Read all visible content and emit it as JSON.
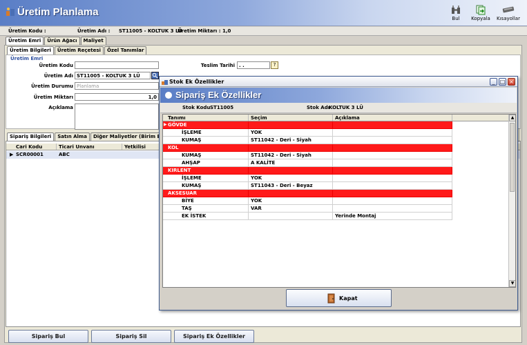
{
  "app": {
    "title": "Üretim Planlama"
  },
  "toolbar": {
    "find_label": "Bul",
    "copy_label": "Kopyala",
    "shortcuts_label": "Kısayollar"
  },
  "infobar": {
    "code_label": "Üretim Kodu :",
    "name_label": "Üretim Adı :",
    "name_value": "ST11005 - KOLTUK 3 LÜ",
    "qty_label": "Üretim Miktarı :",
    "qty_value": "1,0"
  },
  "main_tabs": [
    "Üretim Emri",
    "Ürün Ağacı",
    "Maliyet"
  ],
  "sub_tabs": [
    "Üretim Bilgileri",
    "Üretim Reçetesi",
    "Özel Tanımlar"
  ],
  "form": {
    "section_title": "Üretim Emri",
    "code_label": "Üretim Kodu",
    "code_value": "",
    "name_label": "Üretim Adı",
    "name_value": "ST11005 - KOLTUK 3 LÜ",
    "status_label": "Üretim Durumu",
    "status_value": "Planlama",
    "qty_label": "Üretim Miktarı",
    "qty_value": "1,0",
    "desc_label": "Açıklama",
    "delivery_label": "Teslim Tarihi",
    "delivery_value": ". ."
  },
  "bottom_tabs": [
    "Sipariş Bilgileri",
    "Satın Alma",
    "Diğer Maliyetler (Birim Bazında)"
  ],
  "orders": {
    "columns": [
      "Cari Kodu",
      "Ticari Unvanı",
      "Yetkilisi"
    ],
    "rows": [
      {
        "code": "SCR00001",
        "name": "ABC",
        "contact": ""
      }
    ]
  },
  "bottom_buttons": {
    "find": "Sipariş Bul",
    "delete": "Sipariş Sil",
    "extras": "Sipariş Ek Özellikler"
  },
  "dialog": {
    "window_title": "Stok Ek Özellikler",
    "header_title": "Sipariş Ek Özellikler",
    "stock_code_label": "Stok Kodu",
    "stock_code_value": "ST11005",
    "stock_name_label": "Stok Adı",
    "stock_name_value": "KOLTUK 3 LÜ",
    "columns": [
      "Tanımı",
      "Seçim",
      "Açıklama"
    ],
    "rows": [
      {
        "type": "group",
        "name": "GÖVDE",
        "choice": "",
        "note": ""
      },
      {
        "type": "item",
        "name": "İŞLEME",
        "choice": "YOK",
        "note": ""
      },
      {
        "type": "item",
        "name": "KUMAŞ",
        "choice": "ST11042 - Deri - Siyah",
        "note": ""
      },
      {
        "type": "group",
        "name": "KOL",
        "choice": "",
        "note": ""
      },
      {
        "type": "item",
        "name": "KUMAŞ",
        "choice": "ST11042 - Deri - Siyah",
        "note": ""
      },
      {
        "type": "item",
        "name": "AHŞAP",
        "choice": "A KALİTE",
        "note": ""
      },
      {
        "type": "group",
        "name": "KIRLENT",
        "choice": "",
        "note": ""
      },
      {
        "type": "item",
        "name": "İŞLEME",
        "choice": "YOK",
        "note": ""
      },
      {
        "type": "item",
        "name": "KUMAŞ",
        "choice": "ST11043 - Deri - Beyaz",
        "note": ""
      },
      {
        "type": "group",
        "name": "AKSESUAR",
        "choice": "",
        "note": ""
      },
      {
        "type": "item",
        "name": "BİYE",
        "choice": "YOK",
        "note": ""
      },
      {
        "type": "item",
        "name": "TAŞ",
        "choice": "VAR",
        "note": ""
      },
      {
        "type": "item",
        "name": "EK İSTEK",
        "choice": "",
        "note": "Yerinde Montaj"
      }
    ],
    "close_label": "Kapat"
  },
  "colors": {
    "group_row": "#ff1a1a",
    "header_blue": "#5a7ec6"
  }
}
